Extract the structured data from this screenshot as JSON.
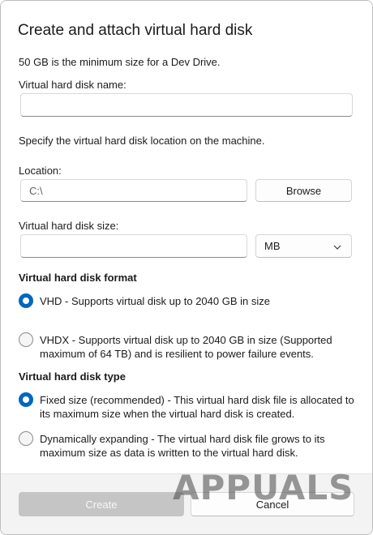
{
  "dialog": {
    "title": "Create and attach virtual hard disk",
    "min_size_note": "50 GB is the minimum size for a Dev Drive.",
    "name_label": "Virtual hard disk name:",
    "name_value": "",
    "location_instruction": "Specify the virtual hard disk location on the machine.",
    "location_label": "Location:",
    "location_value": "C:\\",
    "browse_label": "Browse",
    "size_label": "Virtual hard disk size:",
    "size_value": "",
    "size_unit": "MB",
    "format_heading": "Virtual hard disk format",
    "format_options": [
      {
        "label": "VHD - Supports virtual disk up to 2040 GB in size",
        "selected": true
      },
      {
        "label_line1": "VHDX - Supports virtual disk up to 2040 GB in size (Supported",
        "label_line2": "maximum of 64 TB) and is resilient to power failure events.",
        "selected": false
      }
    ],
    "type_heading": "Virtual hard disk type",
    "type_options": [
      {
        "label_line1": "Fixed size (recommended) - This virtual hard disk file is allocated to",
        "label_line2": "its maximum size when the virtual hard disk is created.",
        "selected": true
      },
      {
        "label_line1": "Dynamically expanding - The virtual hard disk file grows to its",
        "label_line2": "maximum size as data is written to the virtual hard disk.",
        "selected": false
      }
    ],
    "create_label": "Create",
    "cancel_label": "Cancel"
  },
  "watermark": "APPUALS",
  "colors": {
    "accent": "#0067c0",
    "disabled_button": "#c5c5c5",
    "footer": "#f3f3f3"
  }
}
